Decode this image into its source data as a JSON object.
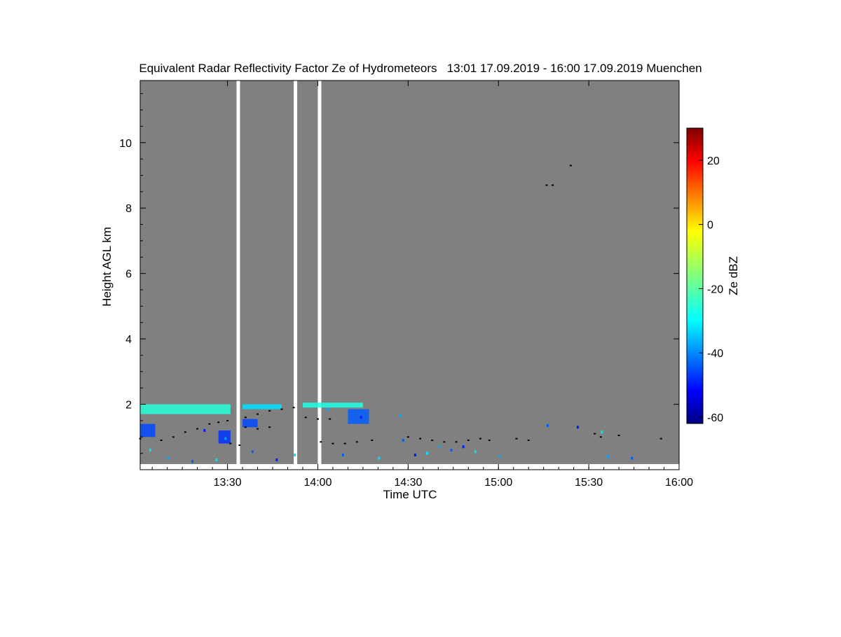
{
  "chart_data": {
    "type": "heatmap",
    "title": "Equivalent Radar Reflectivity Factor Ze of Hydrometeors",
    "time_range": "13:01 17.09.2019 - 16:00 17.09.2019",
    "location": "Muenchen",
    "xlabel": "Time UTC",
    "ylabel": "Height AGL km",
    "x_start": "13:01",
    "x_end": "16:00",
    "x_ticks": [
      "13:30",
      "14:00",
      "14:30",
      "15:00",
      "15:30",
      "16:00"
    ],
    "ylim": [
      0,
      11.9
    ],
    "y_ticks": [
      2,
      4,
      6,
      8,
      10
    ],
    "colorbar": {
      "label": "Ze dBZ",
      "range": [
        -62,
        30
      ],
      "ticks": [
        -60,
        -40,
        -20,
        0,
        20
      ],
      "colormap": "jet"
    },
    "background_color": "#808080",
    "gap_color": "#ffffff",
    "no_data_intervals": [
      [
        "13:33",
        "13:34"
      ],
      [
        "13:52",
        "13:53"
      ],
      [
        "14:00",
        "14:01"
      ]
    ],
    "echo_layers": [
      {
        "start": "13:01",
        "end": "13:31",
        "bottom_km": 1.7,
        "top_km": 2.0,
        "ze_dbz": -24
      },
      {
        "start": "13:35",
        "end": "13:48",
        "bottom_km": 1.85,
        "top_km": 2.0,
        "ze_dbz": -30
      },
      {
        "start": "13:55",
        "end": "14:15",
        "bottom_km": 1.9,
        "top_km": 2.05,
        "ze_dbz": -25
      },
      {
        "start": "14:10",
        "end": "14:17",
        "bottom_km": 1.4,
        "top_km": 1.85,
        "ze_dbz": -42
      },
      {
        "start": "13:01",
        "end": "13:06",
        "bottom_km": 1.0,
        "top_km": 1.4,
        "ze_dbz": -44
      },
      {
        "start": "13:27",
        "end": "13:31",
        "bottom_km": 0.8,
        "top_km": 1.2,
        "ze_dbz": -46
      },
      {
        "start": "13:35",
        "end": "13:40",
        "bottom_km": 1.3,
        "top_km": 1.55,
        "ze_dbz": -44
      }
    ],
    "cloud_base_points": [
      [
        "13:01",
        0.95
      ],
      [
        "13:08",
        0.9
      ],
      [
        "13:12",
        1.0
      ],
      [
        "13:16",
        1.15
      ],
      [
        "13:20",
        1.25
      ],
      [
        "13:24",
        1.4
      ],
      [
        "13:27",
        1.45
      ],
      [
        "13:30",
        1.5
      ],
      [
        "13:31",
        0.8
      ],
      [
        "13:34",
        0.75
      ],
      [
        "13:36",
        1.6
      ],
      [
        "13:40",
        1.7
      ],
      [
        "13:44",
        1.8
      ],
      [
        "13:48",
        1.85
      ],
      [
        "13:52",
        1.9
      ],
      [
        "13:36",
        1.3
      ],
      [
        "13:40",
        1.25
      ],
      [
        "13:44",
        1.3
      ],
      [
        "13:56",
        1.6
      ],
      [
        "14:00",
        1.55
      ],
      [
        "14:04",
        1.55
      ],
      [
        "14:01",
        0.85
      ],
      [
        "14:05",
        0.8
      ],
      [
        "14:09",
        0.8
      ],
      [
        "14:13",
        0.85
      ],
      [
        "14:18",
        0.9
      ],
      [
        "14:30",
        1.0
      ],
      [
        "14:34",
        0.95
      ],
      [
        "14:38",
        0.9
      ],
      [
        "14:42",
        0.85
      ],
      [
        "14:46",
        0.85
      ],
      [
        "14:50",
        0.9
      ],
      [
        "14:54",
        0.95
      ],
      [
        "14:57",
        0.9
      ],
      [
        "15:06",
        0.95
      ],
      [
        "15:10",
        0.9
      ],
      [
        "15:32",
        1.1
      ],
      [
        "15:34",
        1.0
      ],
      [
        "15:40",
        1.05
      ],
      [
        "15:54",
        0.95
      ],
      [
        "15:16",
        8.7
      ],
      [
        "15:18",
        8.7
      ],
      [
        "15:24",
        9.3
      ]
    ],
    "echo_speckles": [
      [
        "13:04",
        0.6
      ],
      [
        "13:10",
        0.35
      ],
      [
        "13:18",
        0.25
      ],
      [
        "13:22",
        1.2
      ],
      [
        "13:26",
        0.3
      ],
      [
        "13:29",
        0.95
      ],
      [
        "13:38",
        0.55
      ],
      [
        "13:46",
        0.3
      ],
      [
        "13:52",
        0.45
      ],
      [
        "14:03",
        1.85
      ],
      [
        "14:08",
        0.45
      ],
      [
        "14:14",
        1.6
      ],
      [
        "14:20",
        0.35
      ],
      [
        "14:27",
        1.65
      ],
      [
        "14:28",
        0.9
      ],
      [
        "14:32",
        0.45
      ],
      [
        "14:36",
        0.5
      ],
      [
        "14:40",
        0.7
      ],
      [
        "14:44",
        0.6
      ],
      [
        "14:48",
        0.7
      ],
      [
        "14:52",
        0.55
      ],
      [
        "15:00",
        0.4
      ],
      [
        "15:16",
        1.35
      ],
      [
        "15:26",
        1.3
      ],
      [
        "15:34",
        1.15
      ],
      [
        "15:36",
        0.4
      ],
      [
        "15:44",
        0.35
      ]
    ]
  }
}
